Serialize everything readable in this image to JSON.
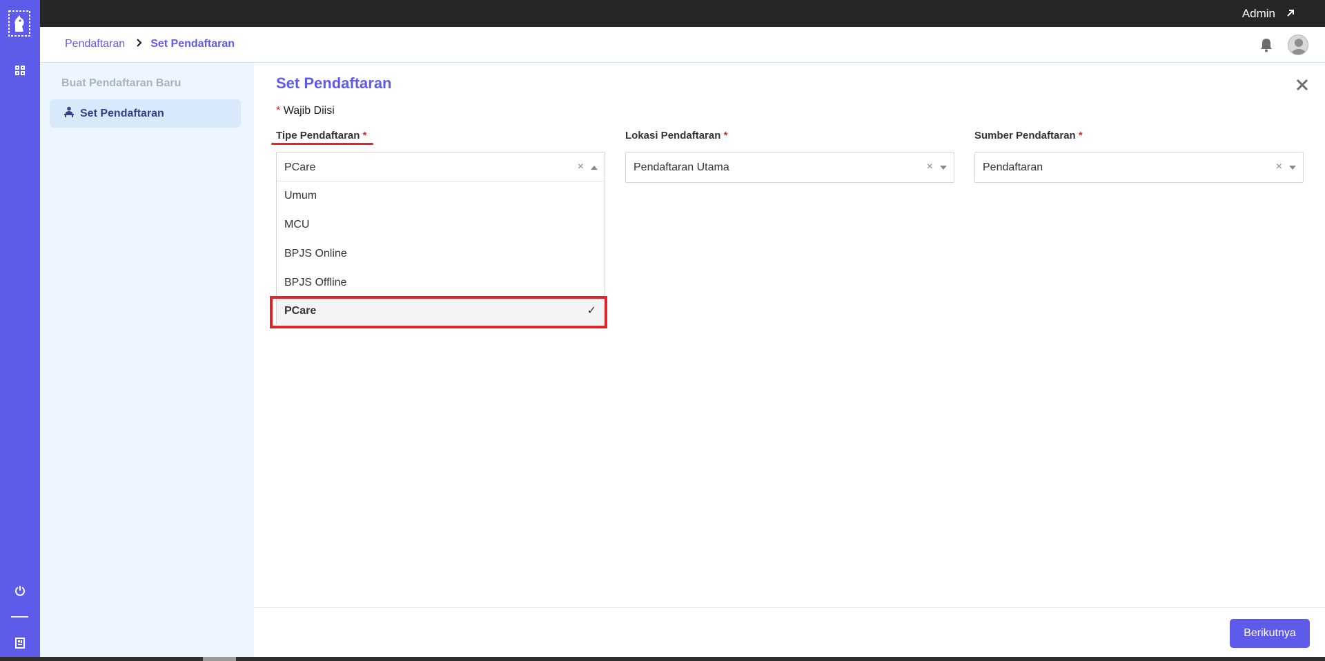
{
  "colors": {
    "brand": "#5f5bea",
    "topbar": "#262626",
    "sidebar_bg": "#edf5fe",
    "highlight": "#e0262a"
  },
  "topbar": {
    "user_label": "Admin",
    "user_icon": "arrow-up-right-icon"
  },
  "rail": {
    "icons": [
      "logo-icon",
      "grid-icon",
      "power-icon",
      "report-icon"
    ]
  },
  "breadcrumb": {
    "parent": "Pendaftaran",
    "separator": "›",
    "current": "Set Pendaftaran"
  },
  "sidebar": {
    "section_title": "Buat Pendaftaran Baru",
    "items": [
      {
        "label": "Set Pendaftaran",
        "icon": "person-desk-icon",
        "active": true
      }
    ]
  },
  "main": {
    "title": "Set Pendaftaran",
    "required_note_star": "*",
    "required_note": "Wajib Diisi",
    "fields": [
      {
        "label": "Tipe Pendaftaran",
        "star": "*",
        "value": "PCare",
        "open": true
      },
      {
        "label": "Lokasi Pendaftaran",
        "star": "*",
        "value": "Pendaftaran Utama",
        "open": false
      },
      {
        "label": "Sumber Pendaftaran",
        "star": "*",
        "value": "Pendaftaran",
        "open": false
      }
    ],
    "clear_symbol": "×",
    "dropdown_options": [
      "Umum",
      "MCU",
      "BPJS Online",
      "BPJS Offline",
      "PCare"
    ],
    "selected_option": "PCare",
    "check_symbol": "✓"
  },
  "footer": {
    "next_label": "Berikutnya"
  }
}
